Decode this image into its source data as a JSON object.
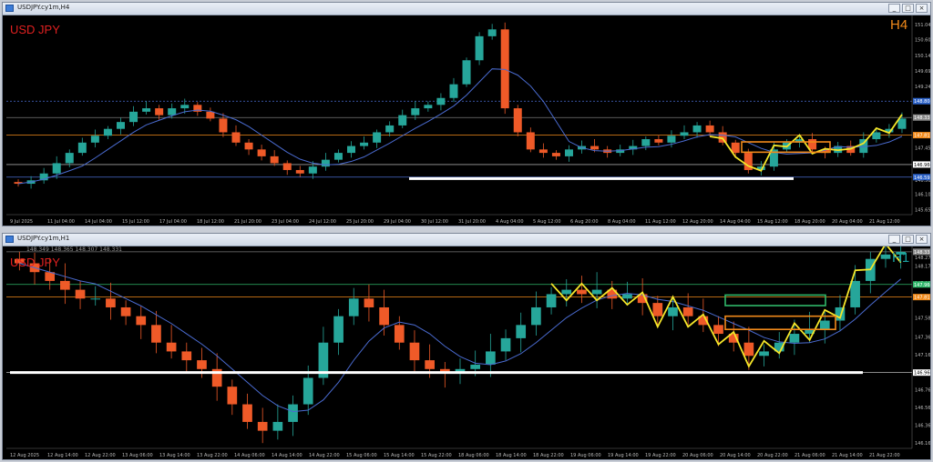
{
  "colors": {
    "bull": "#26a69a",
    "bear": "#ef5a28",
    "ma": "#4a6bd0",
    "zigzag": "#f5e629",
    "support": "#ffffff",
    "orange": "#f28a1a",
    "green": "#2fb86a",
    "tf_h4": "#f28a1a",
    "tf_h1": "#1aa0a0"
  },
  "window_top": {
    "title": "USDJPY.cy1m,H4",
    "symbol_label": "USD JPY",
    "timeframe": "H4",
    "info": "",
    "price_ticks": [
      "151.040",
      "150.600",
      "150.140",
      "149.690",
      "149.240",
      "148.800",
      "148.331",
      "147.817",
      "147.455",
      "146.960",
      "146.505",
      "146.100",
      "145.650"
    ],
    "highlight_prices": [
      {
        "text": "148.808",
        "color": "#2c62c8"
      },
      {
        "text": "148.331",
        "color": "#888888"
      },
      {
        "text": "147.817",
        "color": "#f28a1a"
      },
      {
        "text": "146.960",
        "color": "#ffffff"
      },
      {
        "text": "146.593",
        "color": "#2c62c8"
      }
    ],
    "time_ticks": [
      "9 Jul 2025",
      "11 Jul 04:00",
      "14 Jul 04:00",
      "15 Jul 12:00",
      "17 Jul 04:00",
      "18 Jul 12:00",
      "21 Jul 20:00",
      "23 Jul 04:00",
      "24 Jul 12:00",
      "25 Jul 20:00",
      "29 Jul 04:00",
      "30 Jul 12:00",
      "31 Jul 20:00",
      "4 Aug 04:00",
      "5 Aug 12:00",
      "6 Aug 20:00",
      "8 Aug 04:00",
      "11 Aug 12:00",
      "12 Aug 20:00",
      "14 Aug 04:00",
      "15 Aug 12:00",
      "18 Aug 20:00",
      "20 Aug 04:00",
      "21 Aug 12:00"
    ]
  },
  "window_bottom": {
    "title": "USDJPY.cy1m,H1",
    "info": "148.349 148.365 148.307 148.331",
    "symbol_label": "USD JPY",
    "timeframe": "H1",
    "price_ticks": [
      "148.270",
      "148.170",
      "147.980",
      "147.817",
      "147.580",
      "147.365",
      "147.165",
      "146.960",
      "146.765",
      "146.565",
      "146.365",
      "146.160"
    ],
    "highlight_prices": [
      {
        "text": "148.331",
        "color": "#888888"
      },
      {
        "text": "147.960",
        "color": "#2fb86a"
      },
      {
        "text": "147.817",
        "color": "#f28a1a"
      },
      {
        "text": "146.960",
        "color": "#ffffff"
      }
    ],
    "time_ticks": [
      "12 Aug 2025",
      "12 Aug 14:00",
      "12 Aug 22:00",
      "13 Aug 06:00",
      "13 Aug 14:00",
      "13 Aug 22:00",
      "14 Aug 06:00",
      "14 Aug 14:00",
      "14 Aug 22:00",
      "15 Aug 06:00",
      "15 Aug 14:00",
      "15 Aug 22:00",
      "18 Aug 06:00",
      "18 Aug 14:00",
      "18 Aug 22:00",
      "19 Aug 06:00",
      "19 Aug 14:00",
      "19 Aug 22:00",
      "20 Aug 06:00",
      "20 Aug 14:00",
      "20 Aug 22:00",
      "21 Aug 06:00",
      "21 Aug 14:00",
      "21 Aug 22:00"
    ]
  },
  "chart_data": [
    {
      "type": "candlestick",
      "title": "USDJPY.cy1m,H4",
      "timeframe": "H4",
      "ylim": [
        145.5,
        151.2
      ],
      "close": [
        146.4,
        146.5,
        146.7,
        147.0,
        147.3,
        147.6,
        147.8,
        148.0,
        148.2,
        148.5,
        148.6,
        148.4,
        148.6,
        148.7,
        148.5,
        148.3,
        147.9,
        147.6,
        147.4,
        147.2,
        147.0,
        146.8,
        146.7,
        146.9,
        147.1,
        147.3,
        147.5,
        147.6,
        147.9,
        148.1,
        148.4,
        148.6,
        148.7,
        148.9,
        149.3,
        150.0,
        150.7,
        150.9,
        148.6,
        147.9,
        147.4,
        147.3,
        147.2,
        147.4,
        147.5,
        147.4,
        147.3,
        147.4,
        147.5,
        147.7,
        147.6,
        147.8,
        147.9,
        148.1,
        147.9,
        147.6,
        147.3,
        146.8,
        146.9,
        147.4,
        147.6,
        147.7,
        147.4,
        147.3,
        147.5,
        147.3,
        147.7,
        147.9,
        148.0,
        148.3
      ]
    },
    {
      "type": "candlestick",
      "title": "USDJPY.cy1m,H1",
      "timeframe": "H1",
      "ylim": [
        146.1,
        148.35
      ],
      "close": [
        148.2,
        148.1,
        148.0,
        147.9,
        147.8,
        147.8,
        147.7,
        147.6,
        147.5,
        147.3,
        147.2,
        147.1,
        147.0,
        146.8,
        146.6,
        146.4,
        146.3,
        146.4,
        146.6,
        146.9,
        147.3,
        147.6,
        147.8,
        147.7,
        147.5,
        147.3,
        147.1,
        147.0,
        146.95,
        147.0,
        147.05,
        147.2,
        147.35,
        147.5,
        147.7,
        147.85,
        147.9,
        147.85,
        147.9,
        147.8,
        147.85,
        147.75,
        147.6,
        147.7,
        147.6,
        147.5,
        147.4,
        147.3,
        147.15,
        147.2,
        147.3,
        147.4,
        147.45,
        147.55,
        147.7,
        148.0,
        148.25,
        148.3,
        148.33
      ]
    }
  ]
}
